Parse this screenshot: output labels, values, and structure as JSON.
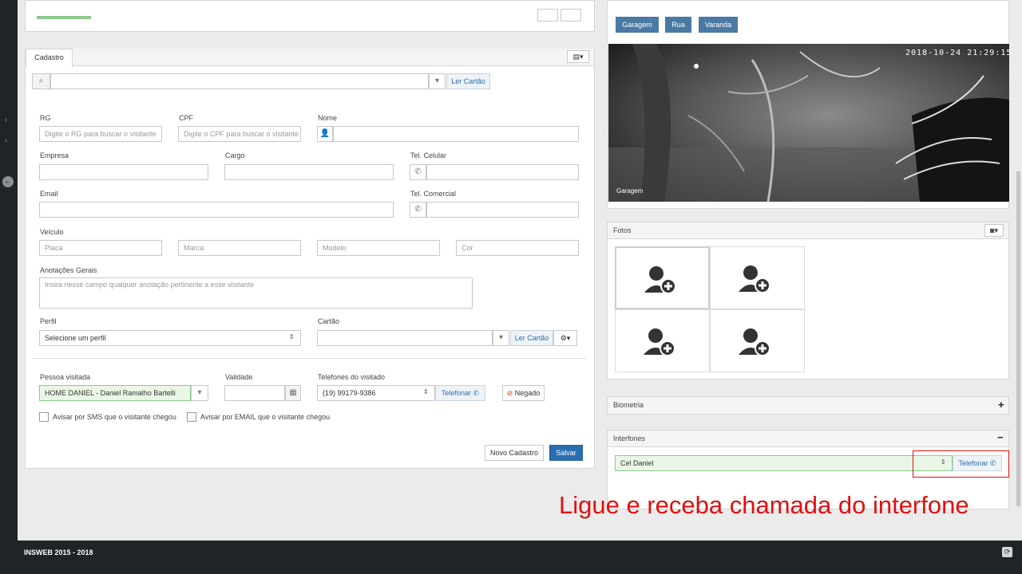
{
  "tab": {
    "label": "Cadastro"
  },
  "search": {
    "read_card": "Ler Cartão"
  },
  "fields": {
    "rg": {
      "label": "RG",
      "placeholder": "Digite o RG para buscar o visitante"
    },
    "cpf": {
      "label": "CPF",
      "placeholder": "Digite o CPF para buscar o visitante"
    },
    "nome": {
      "label": "Nome",
      "value": ""
    },
    "empresa": {
      "label": "Empresa"
    },
    "cargo": {
      "label": "Cargo"
    },
    "tel_celular": {
      "label": "Tel. Celular"
    },
    "email": {
      "label": "Email"
    },
    "tel_comercial": {
      "label": "Tel. Comercial"
    },
    "veiculo": {
      "label": "Veículo",
      "placa": "Placa",
      "marca": "Marca",
      "modelo": "Modelo",
      "cor": "Cor"
    },
    "anotacoes": {
      "label": "Anotações Gerais",
      "placeholder": "Insira nesse campo qualquer anotação pertinente a esse visitante"
    },
    "perfil": {
      "label": "Perfil",
      "value": "Selecione um perfil"
    },
    "cartao": {
      "label": "Cartão",
      "read_card": "Ler Cartão"
    },
    "pessoa_visitada": {
      "label": "Pessoa visitada",
      "value": "HOME DANIEL - Daniel Ramalho Bartelli"
    },
    "validade": {
      "label": "Validade"
    },
    "telefones": {
      "label": "Telefones do visitado",
      "value": "(19) 99179-9386",
      "call": "Telefonar"
    },
    "negado": "Negado",
    "sms": "Avisar por SMS que o visitante chegou",
    "email_notify": "Avisar por EMAIL que o visitante chegou"
  },
  "actions": {
    "novo": "Novo Cadastro",
    "salvar": "Salvar"
  },
  "cameras": {
    "tabs": [
      "Garagem",
      "Rua",
      "Varanda"
    ],
    "timestamp": "2018-10-24 21:29:15",
    "caption": "Garagem"
  },
  "fotos": {
    "title": "Fotos"
  },
  "biometria": {
    "title": "Biometria"
  },
  "interfones": {
    "title": "Interfones",
    "selected": "Cel Daniel",
    "call": "Telefonar"
  },
  "annotation": {
    "text": "Ligue e receba chamada do interfone",
    "color": "#e01010"
  },
  "footer": {
    "text": "INSWEB 2015 - 2018"
  },
  "colors": {
    "primary": "#2a6eb0",
    "camera_tab": "#4a7aa3",
    "success_bg": "#eaf7e6",
    "success_border": "#8cc98c"
  }
}
